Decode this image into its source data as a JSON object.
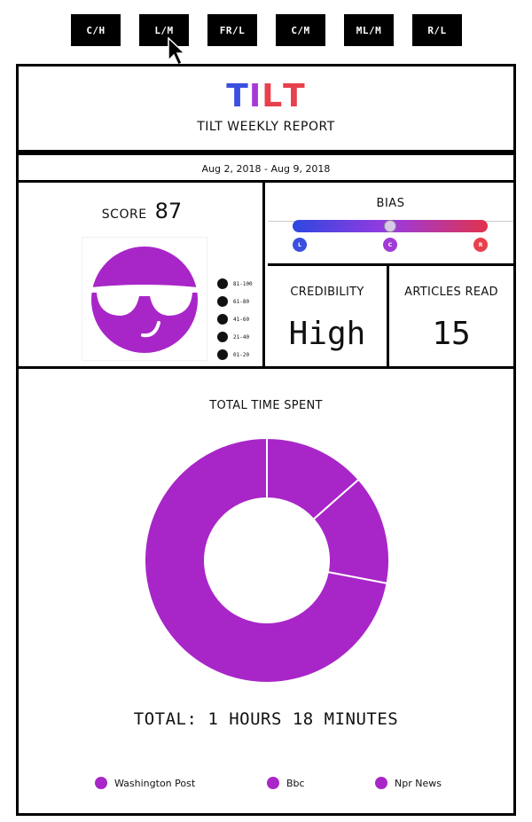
{
  "tabs": [
    "C/H",
    "L/M",
    "FR/L",
    "C/M",
    "ML/M",
    "R/L"
  ],
  "brand": {
    "logo_letters": [
      "T",
      "I",
      "L",
      "T"
    ],
    "logo_colors": [
      "#3b4fe0",
      "#a63ad8",
      "#e8404c",
      "#e8404c"
    ],
    "report_title": "TILT WEEKLY REPORT"
  },
  "date_range": "Aug 2, 2018 - Aug 9, 2018",
  "score": {
    "label": "SCORE",
    "value": "87",
    "face_icon": "cool-sunglasses-face-icon",
    "face_color": "#a826c8",
    "scale": [
      {
        "icon": "sunglasses-face-icon",
        "range": "81-100"
      },
      {
        "icon": "smile-face-icon",
        "range": "61-80"
      },
      {
        "icon": "neutral-face-icon",
        "range": "41-60"
      },
      {
        "icon": "frown-face-icon",
        "range": "21-40"
      },
      {
        "icon": "devil-face-icon",
        "range": "01-20"
      }
    ]
  },
  "bias": {
    "title": "BIAS",
    "level": 0.5,
    "markers": [
      {
        "label": "L",
        "color": "#3a4fe0"
      },
      {
        "label": "C",
        "color": "#a23ad6"
      },
      {
        "label": "R",
        "color": "#e8404c"
      }
    ]
  },
  "credibility": {
    "label": "CREDIBILITY",
    "value": "High"
  },
  "articles": {
    "label": "ARTICLES READ",
    "value": "15"
  },
  "time_spent": {
    "title": "TOTAL TIME SPENT",
    "total": "TOTAL: 1 HOURS 18 MINUTES",
    "color": "#a826c8",
    "chart_data": {
      "type": "pie",
      "categories": [
        "Washington Post",
        "Bbc",
        "Npr News"
      ],
      "values": [
        13.5,
        14.5,
        72.0
      ]
    },
    "legend": [
      "Washington Post",
      "Bbc",
      "Npr News"
    ]
  }
}
